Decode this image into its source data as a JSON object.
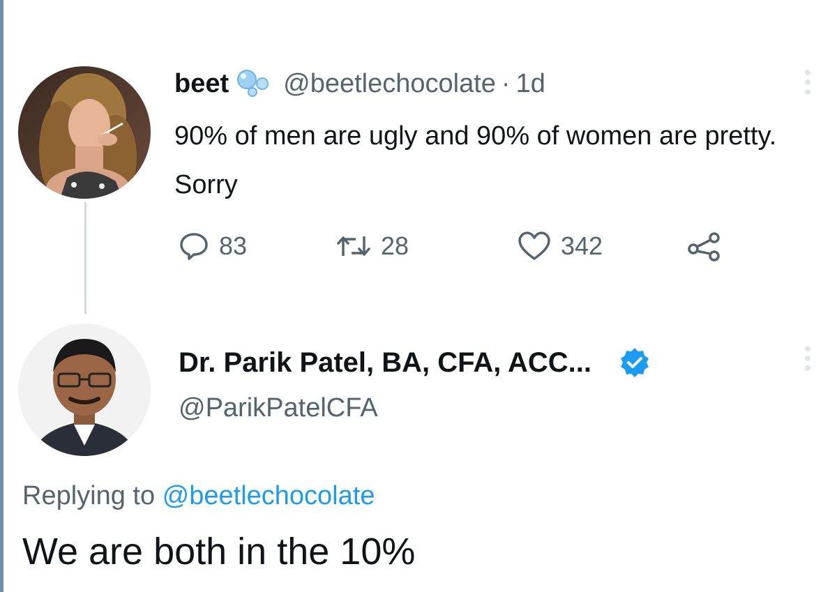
{
  "original_tweet": {
    "display_name": "beet",
    "handle": "@beetlechocolate",
    "separator": "·",
    "timestamp": "1d",
    "text": "90% of men are ugly and 90% of women are pretty. Sorry",
    "counts": {
      "replies": "83",
      "retweets": "28",
      "likes": "342"
    }
  },
  "reply_tweet": {
    "display_name": "Dr. Parik Patel, BA, CFA, ACC...",
    "handle": "@ParikPatelCFA",
    "replying_prefix": "Replying to",
    "replying_to": "@beetlechocolate",
    "text": "We are both in the 10%"
  },
  "colors": {
    "text_primary": "#0f1419",
    "text_secondary": "#536471",
    "accent": "#1d9bf0",
    "thread_line": "#cfd9de"
  },
  "icons": {
    "reply": "speech-bubble-icon",
    "retweet": "retweet-arrows-icon",
    "like": "heart-icon",
    "share": "share-nodes-icon",
    "verified": "verified-badge-icon",
    "more": "vertical-dots-icon"
  }
}
